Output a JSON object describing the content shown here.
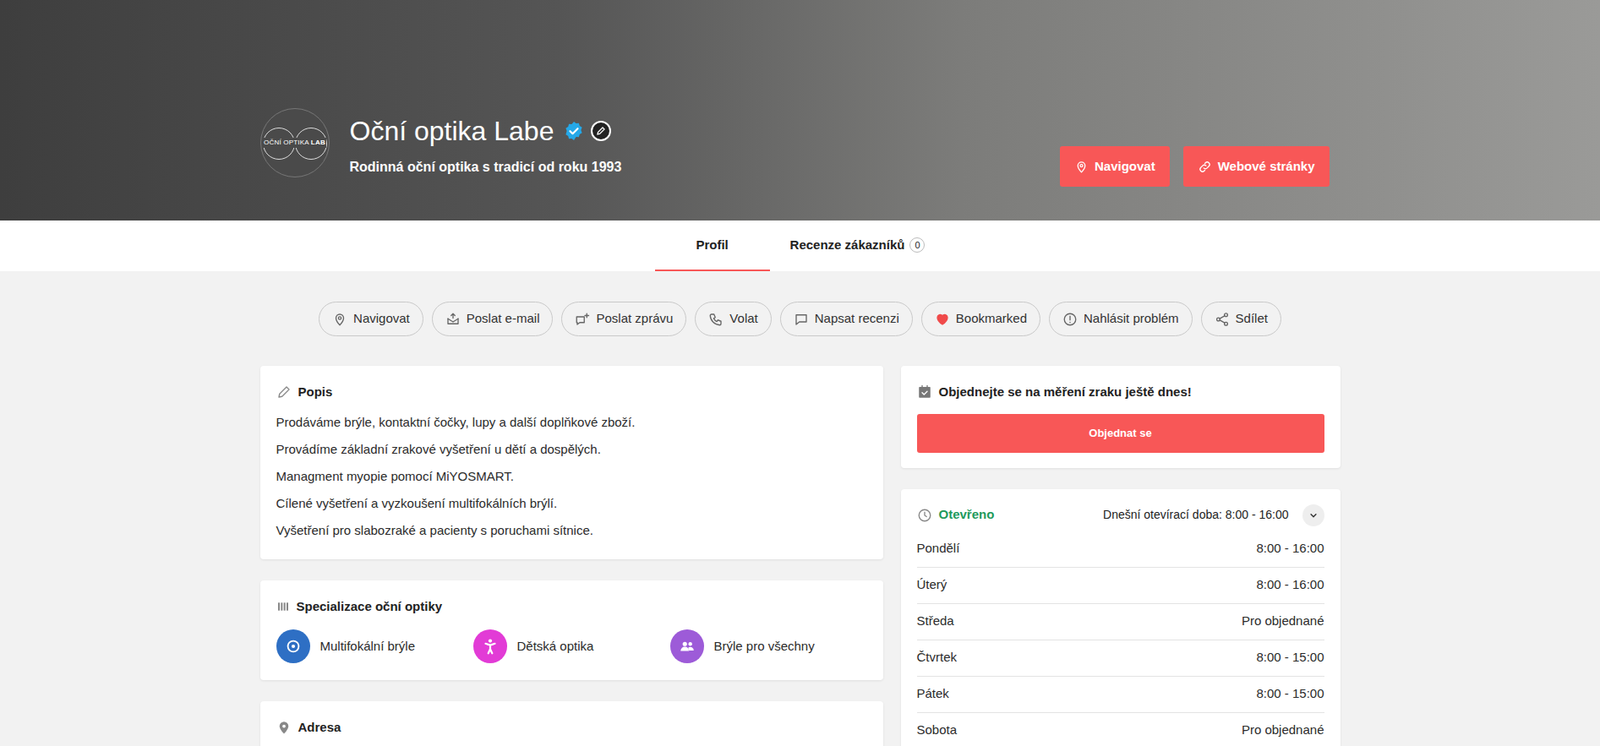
{
  "hero": {
    "logo": {
      "text": "OČNÍ OPTIKA",
      "bold": "LAB"
    },
    "title": "Oční optika Labe",
    "verified": true,
    "subtitle": "Rodinná oční optika s tradicí od roku 1993",
    "buttons": [
      {
        "label": "Navigovat"
      },
      {
        "label": "Webové stránky"
      }
    ]
  },
  "tabs": [
    {
      "label": "Profil",
      "selected": true
    },
    {
      "label": "Recenze zákazníků",
      "count": "0",
      "selected": false
    }
  ],
  "actions": [
    {
      "label": "Navigovat",
      "active": false
    },
    {
      "label": "Poslat e-mail",
      "active": false
    },
    {
      "label": "Poslat zprávu",
      "active": false
    },
    {
      "label": "Volat",
      "active": false
    },
    {
      "label": "Napsat recenzi",
      "active": false
    },
    {
      "label": "Bookmarked",
      "active": true
    },
    {
      "label": "Nahlásit problém",
      "active": false
    },
    {
      "label": "Sdílet",
      "active": false
    }
  ],
  "description": {
    "title": "Popis",
    "lines": [
      "Prodáváme brýle, kontaktní čočky, lupy a další doplňkové zboží.",
      "Provádíme základní zrakové vyšetření u dětí a dospělých.",
      "Managment myopie pomocí MiYOSMART.",
      "Cílené vyšetření a vyzkoušení multifokálních brýlí.",
      "Vyšetření pro slabozraké a pacienty s poruchami sítnice."
    ]
  },
  "specializations": {
    "title": "Specializace oční optiky",
    "items": [
      {
        "label": "Multifokální brýle",
        "color": "#2e6fc4"
      },
      {
        "label": "Dětská optika",
        "color": "#e23bd6"
      },
      {
        "label": "Brýle pro všechny",
        "color": "#9d5bd8"
      }
    ]
  },
  "address": {
    "title": "Adresa"
  },
  "booking": {
    "title": "Objednejte se na měření zraku ještě dnes!",
    "button": "Objednat se"
  },
  "hours": {
    "status": "Otevřeno",
    "today": "Dnešní otevírací doba: 8:00 - 16:00",
    "expanded": true,
    "rows": [
      {
        "day": "Pondělí",
        "time": "8:00 - 16:00"
      },
      {
        "day": "Úterý",
        "time": "8:00 - 16:00"
      },
      {
        "day": "Středa",
        "time": "Pro objednané"
      },
      {
        "day": "Čtvrtek",
        "time": "8:00 - 15:00"
      },
      {
        "day": "Pátek",
        "time": "8:00 - 15:00"
      },
      {
        "day": "Sobota",
        "time": "Pro objednané"
      }
    ]
  }
}
